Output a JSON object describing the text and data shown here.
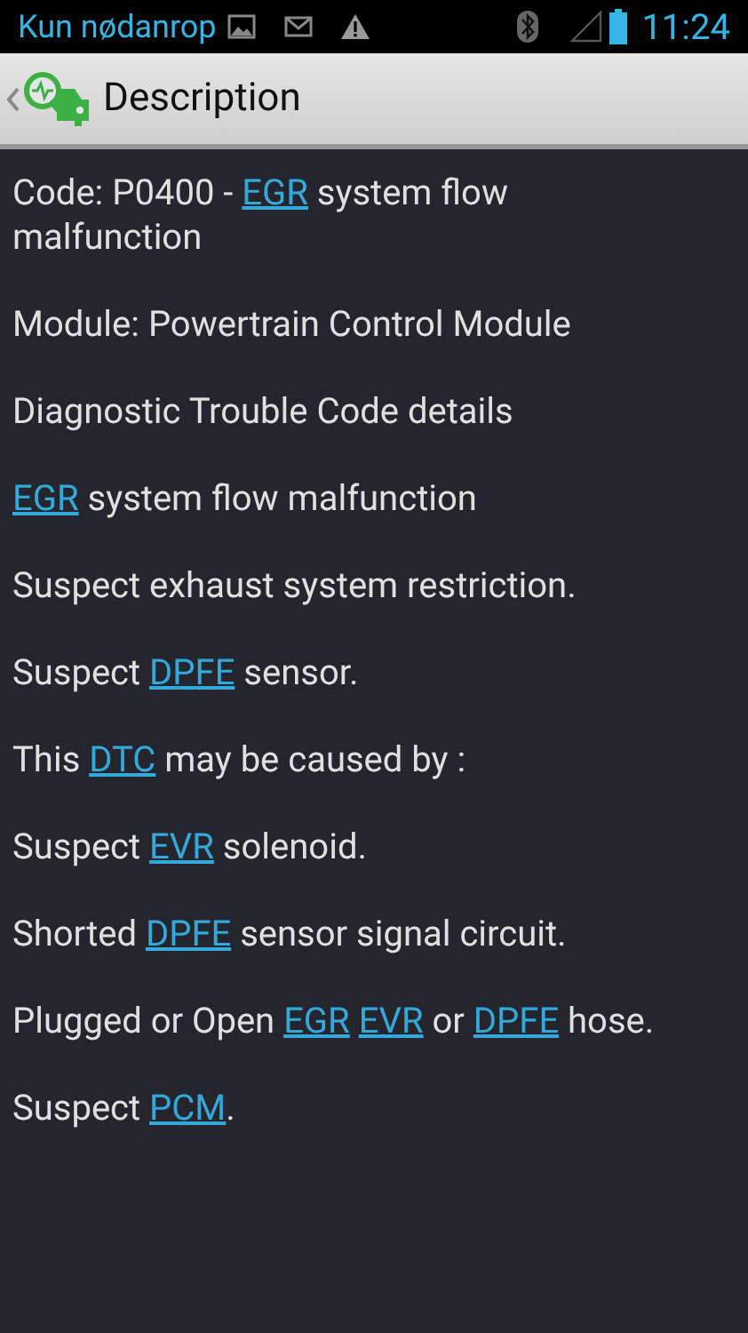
{
  "status_bar": {
    "carrier": "Kun nødanrop",
    "time": "11:24"
  },
  "header": {
    "title": "Description"
  },
  "paragraphs": [
    [
      {
        "text": "Code: P0400 - ",
        "link": false
      },
      {
        "text": "EGR",
        "link": true
      },
      {
        "text": " system flow malfunction",
        "link": false
      }
    ],
    [
      {
        "text": "Module: Powertrain Control Module",
        "link": false
      }
    ],
    [
      {
        "text": "Diagnostic Trouble Code details",
        "link": false
      }
    ],
    [
      {
        "text": "EGR",
        "link": true
      },
      {
        "text": " system flow malfunction",
        "link": false
      }
    ],
    [
      {
        "text": "Suspect exhaust system restriction.",
        "link": false
      }
    ],
    [
      {
        "text": "Suspect ",
        "link": false
      },
      {
        "text": "DPFE",
        "link": true
      },
      {
        "text": " sensor.",
        "link": false
      }
    ],
    [
      {
        "text": "This ",
        "link": false
      },
      {
        "text": "DTC",
        "link": true
      },
      {
        "text": " may be caused by :",
        "link": false
      }
    ],
    [
      {
        "text": "Suspect ",
        "link": false
      },
      {
        "text": "EVR",
        "link": true
      },
      {
        "text": " solenoid.",
        "link": false
      }
    ],
    [
      {
        "text": "Shorted ",
        "link": false
      },
      {
        "text": "DPFE",
        "link": true
      },
      {
        "text": " sensor signal circuit.",
        "link": false
      }
    ],
    [
      {
        "text": "Plugged or Open ",
        "link": false
      },
      {
        "text": "EGR",
        "link": true
      },
      {
        "text": "EVR",
        "link": true
      },
      {
        "text": " or ",
        "link": false
      },
      {
        "text": "DPFE",
        "link": true
      },
      {
        "text": " hose.",
        "link": false
      }
    ],
    [
      {
        "text": "Suspect ",
        "link": false
      },
      {
        "text": "PCM",
        "link": true
      },
      {
        "text": ".",
        "link": false
      }
    ]
  ]
}
